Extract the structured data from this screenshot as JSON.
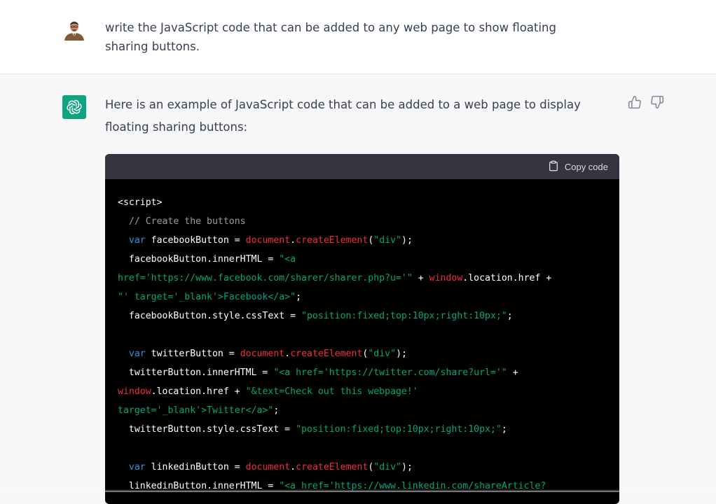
{
  "user_message": {
    "text": "write the JavaScript code that can be added to any web page to show floating sharing buttons."
  },
  "assistant_message": {
    "intro": "Here is an example of JavaScript code that can be added to a web page to display floating sharing buttons:",
    "copy_label": "Copy code",
    "code_lines": [
      [
        {
          "t": "<script>",
          "c": ""
        }
      ],
      [
        {
          "t": "  // Create the buttons",
          "c": "com"
        }
      ],
      [
        {
          "t": "  ",
          "c": ""
        },
        {
          "t": "var",
          "c": "kw"
        },
        {
          "t": " facebookButton = ",
          "c": ""
        },
        {
          "t": "document",
          "c": "bi"
        },
        {
          "t": ".",
          "c": ""
        },
        {
          "t": "createElement",
          "c": "bi"
        },
        {
          "t": "(",
          "c": ""
        },
        {
          "t": "\"div\"",
          "c": "str"
        },
        {
          "t": ");",
          "c": ""
        }
      ],
      [
        {
          "t": "  facebookButton.innerHTML = ",
          "c": ""
        },
        {
          "t": "\"<a",
          "c": "str"
        }
      ],
      [
        {
          "t": "href='https://www.facebook.com/sharer/sharer.php?u='\"",
          "c": "str"
        },
        {
          "t": " + ",
          "c": ""
        },
        {
          "t": "window",
          "c": "bi"
        },
        {
          "t": ".location.href +",
          "c": ""
        }
      ],
      [
        {
          "t": "\"' target='_blank'>Facebook</a>\"",
          "c": "str"
        },
        {
          "t": ";",
          "c": ""
        }
      ],
      [
        {
          "t": "  facebookButton.style.cssText = ",
          "c": ""
        },
        {
          "t": "\"position:fixed;top:10px;right:10px;\"",
          "c": "str"
        },
        {
          "t": ";",
          "c": ""
        }
      ],
      [
        {
          "t": "",
          "c": ""
        }
      ],
      [
        {
          "t": "  ",
          "c": ""
        },
        {
          "t": "var",
          "c": "kw"
        },
        {
          "t": " twitterButton = ",
          "c": ""
        },
        {
          "t": "document",
          "c": "bi"
        },
        {
          "t": ".",
          "c": ""
        },
        {
          "t": "createElement",
          "c": "bi"
        },
        {
          "t": "(",
          "c": ""
        },
        {
          "t": "\"div\"",
          "c": "str"
        },
        {
          "t": ");",
          "c": ""
        }
      ],
      [
        {
          "t": "  twitterButton.innerHTML = ",
          "c": ""
        },
        {
          "t": "\"<a href='https://twitter.com/share?url='\"",
          "c": "str"
        },
        {
          "t": " +",
          "c": ""
        }
      ],
      [
        {
          "t": "window",
          "c": "bi"
        },
        {
          "t": ".location.href + ",
          "c": ""
        },
        {
          "t": "\"&text=Check out this webpage!'",
          "c": "str"
        }
      ],
      [
        {
          "t": "target='_blank'>Twitter</a>\"",
          "c": "str"
        },
        {
          "t": ";",
          "c": ""
        }
      ],
      [
        {
          "t": "  twitterButton.style.cssText = ",
          "c": ""
        },
        {
          "t": "\"position:fixed;top:10px;right:10px;\"",
          "c": "str"
        },
        {
          "t": ";",
          "c": ""
        }
      ],
      [
        {
          "t": "",
          "c": ""
        }
      ],
      [
        {
          "t": "  ",
          "c": ""
        },
        {
          "t": "var",
          "c": "kw"
        },
        {
          "t": " linkedinButton = ",
          "c": ""
        },
        {
          "t": "document",
          "c": "bi"
        },
        {
          "t": ".",
          "c": ""
        },
        {
          "t": "createElement",
          "c": "bi"
        },
        {
          "t": "(",
          "c": ""
        },
        {
          "t": "\"div\"",
          "c": "str"
        },
        {
          "t": ");",
          "c": ""
        }
      ],
      [
        {
          "t": "  linkedinButton.innerHTML = ",
          "c": ""
        },
        {
          "t": "\"<a href='https://www.linkedin.com/shareArticle?",
          "c": "str"
        }
      ]
    ]
  },
  "icons": {
    "avatar": "user-avatar",
    "assistant": "openai-logo-icon",
    "copy": "clipboard-icon",
    "like": "thumbs-up-icon",
    "dislike": "thumbs-down-icon"
  },
  "colors": {
    "accent": "#10a37f",
    "keyword": "#2e95d3",
    "builtin": "#f22c3d",
    "string": "#00a67d"
  }
}
